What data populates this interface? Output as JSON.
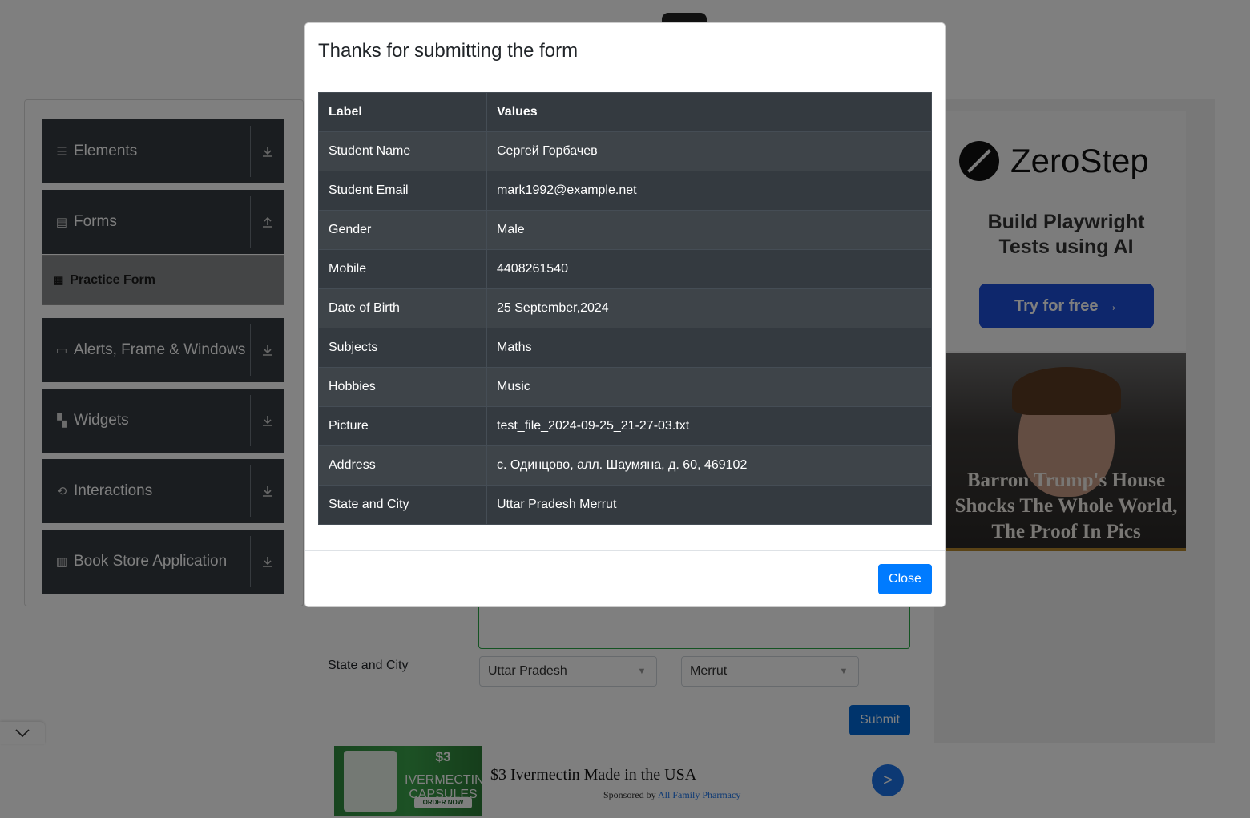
{
  "sidebar": {
    "groups": [
      {
        "label": "Elements",
        "icon": "menu-icon"
      },
      {
        "label": "Forms",
        "icon": "document-icon"
      },
      {
        "label": "Alerts, Frame & Windows",
        "icon": "window-icon"
      },
      {
        "label": "Widgets",
        "icon": "widgets-icon"
      },
      {
        "label": "Interactions",
        "icon": "interactions-icon"
      },
      {
        "label": "Book Store Application",
        "icon": "books-icon"
      }
    ],
    "active_item": "Practice Form"
  },
  "form": {
    "state_city_label": "State and City",
    "state_value": "Uttar Pradesh",
    "city_value": "Merrut",
    "submit_label": "Submit"
  },
  "modal": {
    "title": "Thanks for submitting the form",
    "columns": [
      "Label",
      "Values"
    ],
    "rows": [
      {
        "label": "Student Name",
        "value": "Сергей Горбачев"
      },
      {
        "label": "Student Email",
        "value": "mark1992@example.net"
      },
      {
        "label": "Gender",
        "value": "Male"
      },
      {
        "label": "Mobile",
        "value": "4408261540"
      },
      {
        "label": "Date of Birth",
        "value": "25 September,2024"
      },
      {
        "label": "Subjects",
        "value": "Maths"
      },
      {
        "label": "Hobbies",
        "value": "Music"
      },
      {
        "label": "Picture",
        "value": "test_file_2024-09-25_21-27-03.txt"
      },
      {
        "label": "Address",
        "value": "с. Одинцово, алл. Шаумяна, д. 60, 469102"
      },
      {
        "label": "State and City",
        "value": "Uttar Pradesh Merrut"
      }
    ],
    "close_label": "Close"
  },
  "ads": {
    "zerostep": {
      "brand": "ZeroStep",
      "tagline_1": "Build Playwright",
      "tagline_2": "Tests using AI",
      "button": "Try for free →"
    },
    "barron": {
      "headline": "Barron Trump's House Shocks The Whole World, The Proof In Pics"
    },
    "bottom": {
      "img_line1": "$3",
      "img_line2": "IVERMECTIN",
      "img_line3": "CAPSULES",
      "img_cta": "ORDER NOW",
      "title": "$3 Ivermectin Made in the USA",
      "sponsor_prefix": "Sponsored by",
      "sponsor_name": "All Family Pharmacy",
      "go": ">"
    }
  },
  "colors": {
    "primary": "#007bff",
    "dark": "#343a40",
    "submit": "#0069d9"
  }
}
